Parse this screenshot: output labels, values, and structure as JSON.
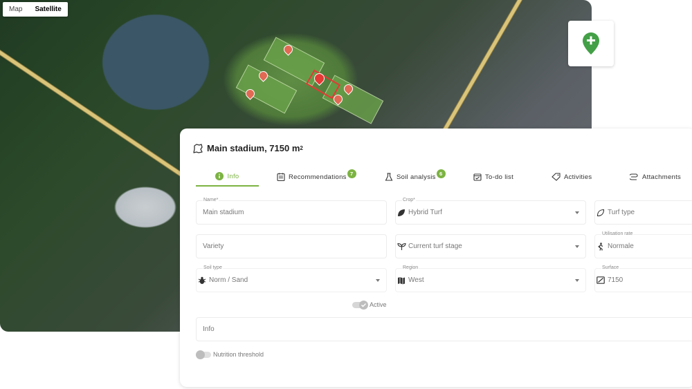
{
  "map": {
    "type_options": [
      "Map",
      "Satellite"
    ],
    "selected_type": "Satellite",
    "add_icon": "map-pin-plus-icon",
    "accent_color": "#43a047",
    "marker_color": "#e53935"
  },
  "panel": {
    "title": "Main stadium, 7150 m",
    "title_superscript": "2",
    "title_icon": "stadium-outline-icon",
    "tabs": [
      {
        "label": "Info",
        "icon": "info-circle-icon",
        "badge": null,
        "active": true
      },
      {
        "label": "Recommendations",
        "icon": "clipboard-list-icon",
        "badge": "7",
        "active": false
      },
      {
        "label": "Soil analysis",
        "icon": "flask-icon",
        "badge": "6",
        "active": false
      },
      {
        "label": "To-do list",
        "icon": "calendar-check-icon",
        "badge": null,
        "active": false
      },
      {
        "label": "Activities",
        "icon": "tag-icon",
        "badge": null,
        "active": false
      },
      {
        "label": "Attachments",
        "icon": "paperclip-icon",
        "badge": null,
        "active": false
      }
    ],
    "fields": {
      "name": {
        "label": "Name*",
        "value": "Main stadium"
      },
      "crop": {
        "label": "Crop*",
        "value": "Hybrid Turf"
      },
      "turf_type": {
        "placeholder": "Turf type"
      },
      "variety": {
        "placeholder": "Variety"
      },
      "turf_stage": {
        "placeholder": "Current turf stage"
      },
      "utilisation": {
        "label": "Utilisation rate",
        "value": "Normale"
      },
      "soil_type": {
        "label": "Soil type",
        "value": "Norm / Sand"
      },
      "region": {
        "label": "Region",
        "value": "West"
      },
      "surface": {
        "label": "Surface",
        "value": "7150"
      },
      "info": {
        "placeholder": "Info"
      }
    },
    "active_toggle": {
      "label": "Active",
      "on": true
    },
    "nutrition_toggle": {
      "label": "Nutrition threshold",
      "on": false
    },
    "accent_color": "#7cb342"
  }
}
